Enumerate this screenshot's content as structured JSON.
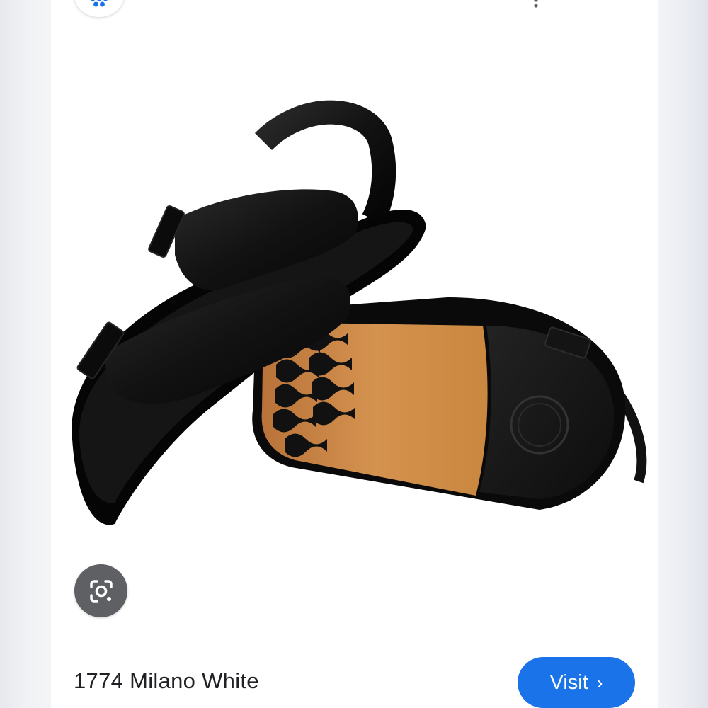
{
  "product": {
    "title": "1774 Milano White",
    "image_alt": "Black two-strap sandal with back strap and tan footbed sole"
  },
  "actions": {
    "visit_label": "Visit",
    "visit_chevron": "›"
  },
  "icons": {
    "source_logo": "source-logo-icon",
    "more": "more-vert-icon",
    "close": "close-icon",
    "lens": "google-lens-icon"
  },
  "colors": {
    "accent": "#1a73e8",
    "lens_bg": "#5f6063",
    "text": "#202124"
  }
}
